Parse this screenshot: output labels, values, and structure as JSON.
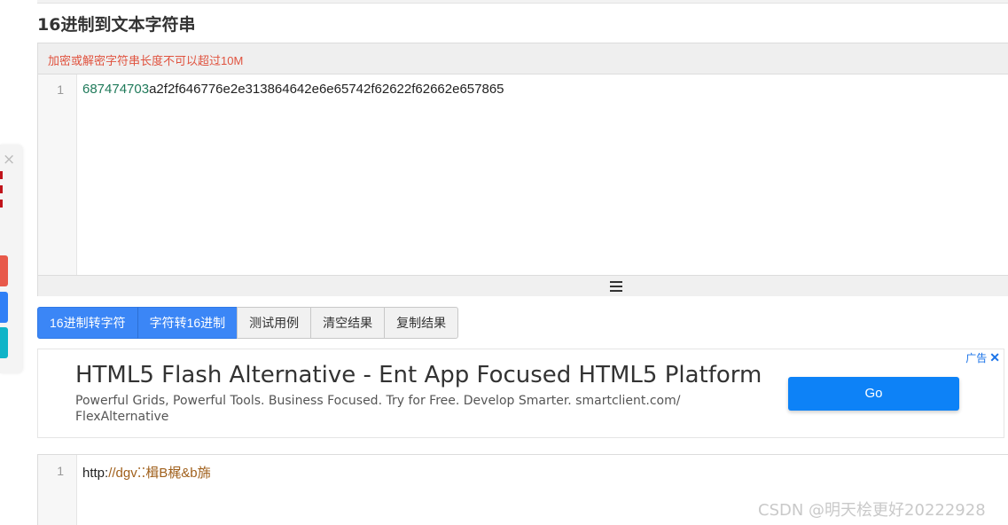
{
  "page": {
    "title": "16进制到文本字符串"
  },
  "input_panel": {
    "warning": "加密或解密字符串长度不可以超过10M",
    "line_number": "1",
    "code_number_part": "687474703",
    "code_rest": "a2f2f646776e2e313864642e6e65742f62622f62662e657865"
  },
  "buttons": {
    "hex_to_text": "16进制转字符",
    "text_to_hex": "字符转16进制",
    "test_case": "测试用例",
    "clear_result": "清空结果",
    "copy_result": "复制结果"
  },
  "ad": {
    "title": "HTML5 Flash Alternative - Ent App Focused HTML5 Platform",
    "description": "Powerful Grids, Powerful Tools. Business Focused. Try for Free. Develop Smarter. smartclient.com/ FlexAlternative",
    "button": "Go",
    "tag": "广告"
  },
  "output_panel": {
    "line_number": "1",
    "code_http_part": "http:",
    "code_rest": "//dgv⁚⁚楫B梶&b旆"
  },
  "float_widget": {
    "close": "×"
  },
  "watermark": "CSDN @明天桧更好20222928",
  "colors": {
    "primary_button": "#3b86f6",
    "warning_text": "#e0533f",
    "ad_button": "#0d82f7"
  }
}
